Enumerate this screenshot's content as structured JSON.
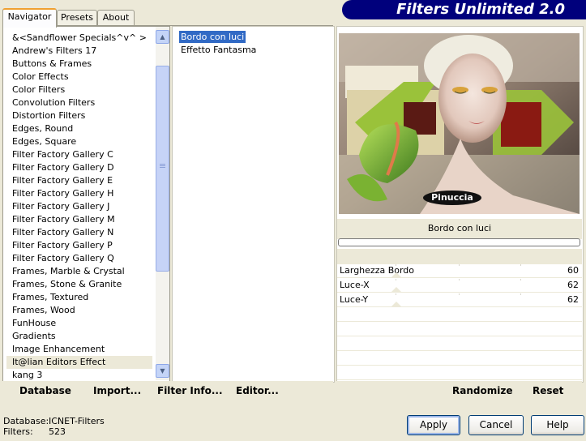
{
  "tabs": [
    {
      "label": "Navigator",
      "active": true
    },
    {
      "label": "Presets",
      "active": false
    },
    {
      "label": "About",
      "active": false
    }
  ],
  "app_title": "Filters Unlimited 2.0",
  "categories": [
    "&<Sandflower Specials^v^ >",
    "Andrew's Filters 17",
    "Buttons & Frames",
    "Color Effects",
    "Color Filters",
    "Convolution Filters",
    "Distortion Filters",
    "Edges, Round",
    "Edges, Square",
    "Filter Factory Gallery C",
    "Filter Factory Gallery D",
    "Filter Factory Gallery E",
    "Filter Factory Gallery H",
    "Filter Factory Gallery J",
    "Filter Factory Gallery M",
    "Filter Factory Gallery N",
    "Filter Factory Gallery P",
    "Filter Factory Gallery Q",
    "Frames, Marble & Crystal",
    "Frames, Stone & Granite",
    "Frames, Textured",
    "Frames, Wood",
    "FunHouse",
    "Gradients",
    "Image Enhancement",
    "It@lian Editors Effect",
    "kang 3"
  ],
  "selected_category": "It@lian Editors Effect",
  "filters": [
    "Bordo con luci",
    "Effetto Fantasma"
  ],
  "selected_filter": "Bordo con luci",
  "preview": {
    "watermark": "Pinuccia"
  },
  "filter_title": "Bordo con luci",
  "params": [
    {
      "name": "Larghezza Bordo",
      "value": "60"
    },
    {
      "name": "Luce-X",
      "value": "62"
    },
    {
      "name": "Luce-Y",
      "value": "62"
    }
  ],
  "actions": {
    "database": "Database",
    "import": "Import...",
    "filter_info": "Filter Info...",
    "editor": "Editor...",
    "randomize": "Randomize",
    "reset": "Reset"
  },
  "status": {
    "database_label": "Database:",
    "database_value": "ICNET-Filters",
    "filters_label": "Filters:",
    "filters_value": "523"
  },
  "buttons": {
    "apply": "Apply",
    "cancel": "Cancel",
    "help": "Help"
  },
  "colors": {
    "banner": "#00007C",
    "selection": "#316AC5",
    "face": "#ECE9D8",
    "active_tab_accent": "#F0A030"
  }
}
